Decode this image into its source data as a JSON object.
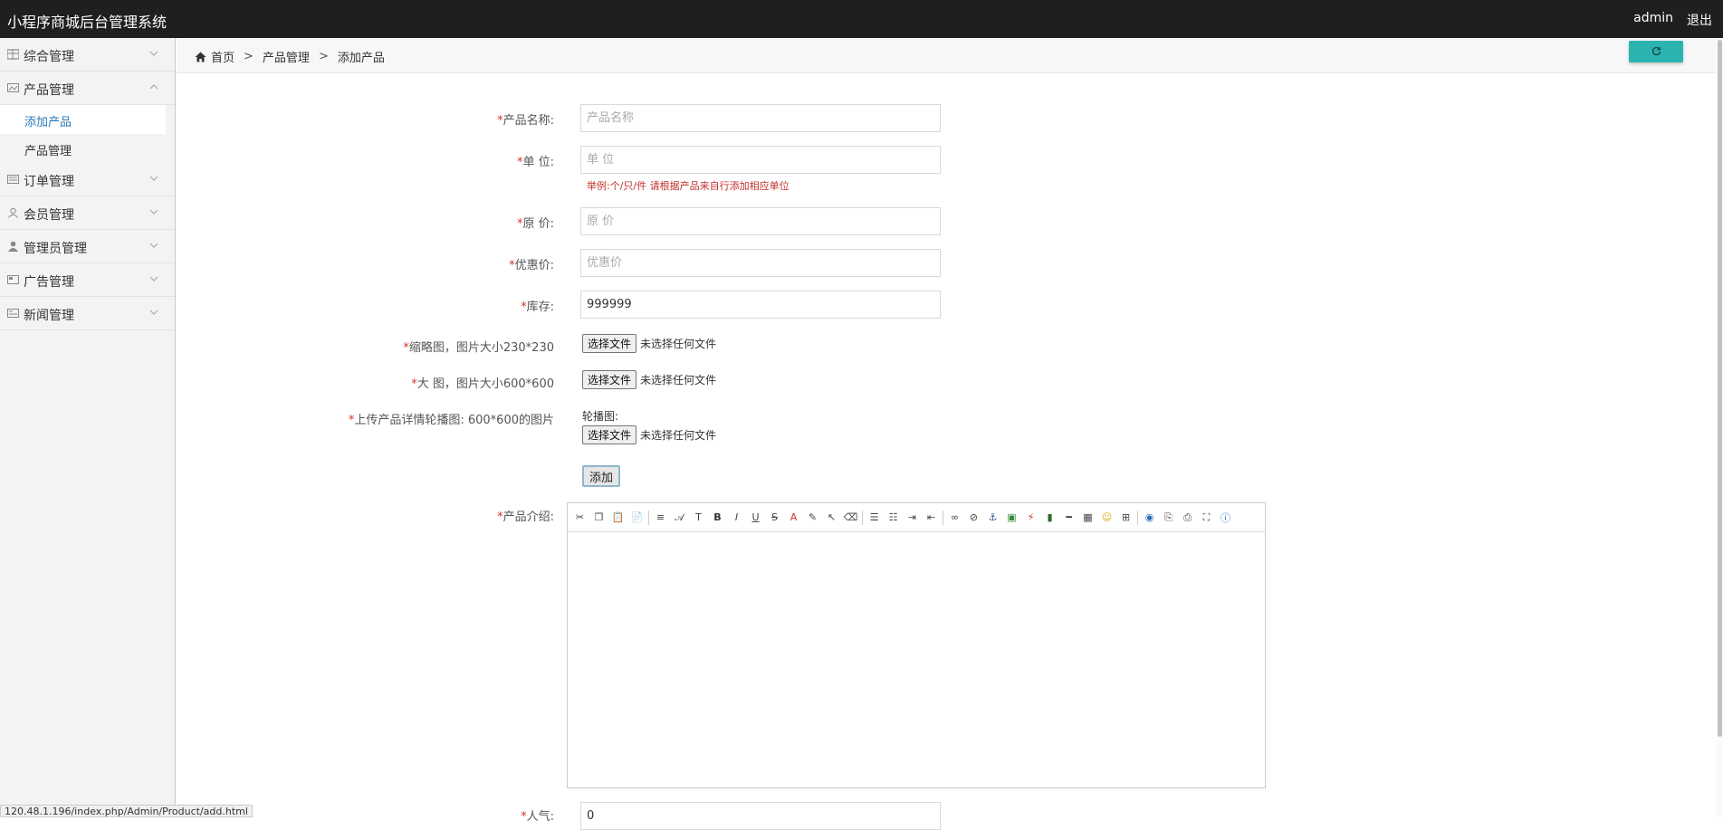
{
  "header": {
    "title": "小程序商城后台管理系统",
    "user": "admin",
    "logout": "退出"
  },
  "sidebar": {
    "groups": [
      {
        "label": "综合管理",
        "icon": "grid-icon"
      },
      {
        "label": "产品管理",
        "icon": "image-icon",
        "expanded": true,
        "items": [
          {
            "label": "添加产品",
            "active": true
          },
          {
            "label": "产品管理"
          }
        ]
      },
      {
        "label": "订单管理",
        "icon": "list-icon"
      },
      {
        "label": "会员管理",
        "icon": "person-icon"
      },
      {
        "label": "管理员管理",
        "icon": "admin-icon"
      },
      {
        "label": "广告管理",
        "icon": "ad-icon"
      },
      {
        "label": "新闻管理",
        "icon": "news-icon"
      }
    ]
  },
  "breadcrumb": {
    "home": "首页",
    "sep": ">",
    "level1": "产品管理",
    "level2": "添加产品"
  },
  "form": {
    "req": "*",
    "name": {
      "label": "产品名称:",
      "placeholder": "产品名称"
    },
    "unit": {
      "label": "单 位:",
      "placeholder": "单 位",
      "hint": "举例:个/只/件 请根据产品来自行添加相应单位"
    },
    "price": {
      "label": "原 价:",
      "placeholder": "原 价"
    },
    "discount": {
      "label": "优惠价:",
      "placeholder": "优惠价"
    },
    "stock": {
      "label": "库存:",
      "value": "999999"
    },
    "thumb": {
      "label": "缩略图，图片大小230*230"
    },
    "big": {
      "label": "大 图，图片大小600*600"
    },
    "carousel": {
      "label": "上传产品详情轮播图: 600*600的图片",
      "subhead": "轮播图:"
    },
    "file_button": "选择文件",
    "file_none": "未选择任何文件",
    "add_button": "添加",
    "intro": {
      "label": "产品介绍:"
    },
    "popularity": {
      "label": "人气:",
      "value": "0"
    }
  },
  "toolbar_icons": [
    "cut-icon",
    "copy-icon",
    "paste-icon",
    "paste-text-icon",
    "sep",
    "align-icon",
    "font-icon",
    "font-size-icon",
    "bold-icon",
    "italic-icon",
    "underline-icon",
    "strikethrough-icon",
    "font-color-icon",
    "highlight-icon",
    "select-icon",
    "eraser-icon",
    "sep",
    "ordered-list-icon",
    "unordered-list-icon",
    "indent-icon",
    "outdent-icon",
    "sep",
    "link-icon",
    "unlink-icon",
    "anchor-icon",
    "image-icon",
    "flash-icon",
    "media-icon",
    "hr-icon",
    "table-icon",
    "emoticon-icon",
    "pagebreak-icon",
    "sep",
    "preview-icon",
    "template-icon",
    "print-icon",
    "fullscreen-icon",
    "about-icon"
  ],
  "status_url": "120.48.1.196/index.php/Admin/Product/add.html",
  "colors": {
    "topbar": "#1f1f1f",
    "accent": "#2ab3b0",
    "required": "#d9302c",
    "active_link": "#2a7ab8"
  }
}
